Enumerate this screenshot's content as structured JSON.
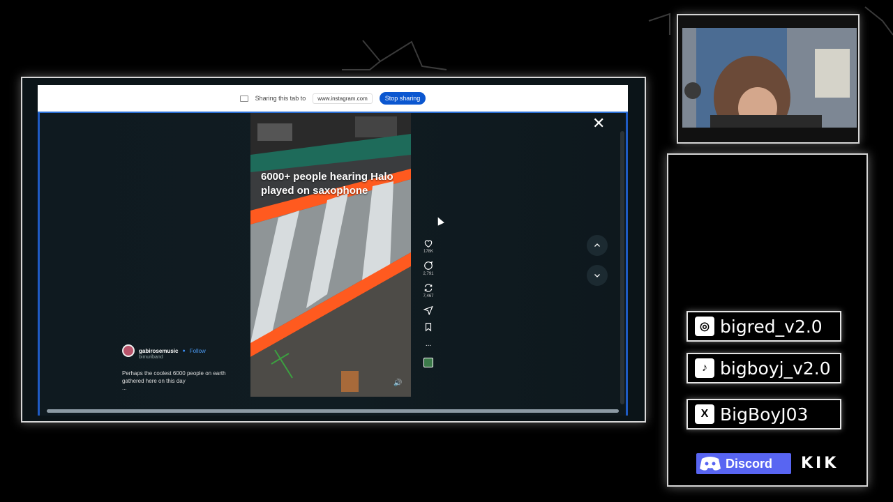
{
  "share_bar": {
    "text": "Sharing this tab to",
    "domain": "www.instagram.com",
    "stop_label": "Stop sharing"
  },
  "post": {
    "caption_overlay": "6000+ people hearing Halo played on saxophone",
    "author": "gabirosemusic",
    "follow_label": "Follow",
    "sub_label": "bimuriband",
    "description": "Perhaps the coolest 6000 people on earth gathered here on this day",
    "more": "...",
    "actions": [
      {
        "icon": "heart-icon",
        "count": "178K"
      },
      {
        "icon": "comment-icon",
        "count": "2,791"
      },
      {
        "icon": "repost-icon",
        "count": "7,467"
      },
      {
        "icon": "share-icon",
        "count": ""
      },
      {
        "icon": "bookmark-icon",
        "count": ""
      },
      {
        "icon": "more-icon",
        "count": "..."
      }
    ]
  },
  "socials": {
    "instagram": "bigred_v2.0",
    "tiktok": "bigboyj_v2.0",
    "x": "BigBoyJ03",
    "discord": "Discord",
    "kik": "KIK"
  },
  "colors": {
    "accent_blue": "#0b57d0",
    "discord": "#5865f2",
    "stripe_orange": "#ff5a1f"
  }
}
